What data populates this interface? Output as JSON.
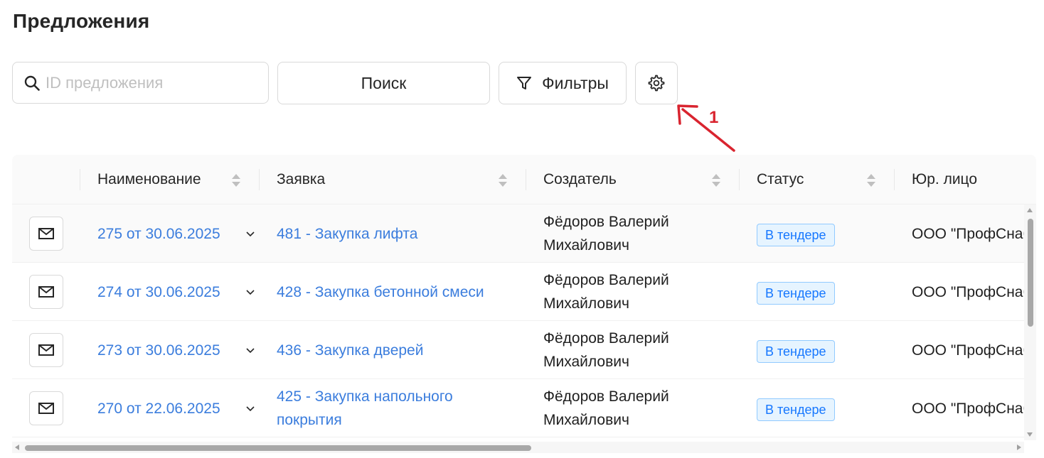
{
  "page": {
    "title": "Предложения"
  },
  "toolbar": {
    "search_placeholder": "ID предложения",
    "search_value": "",
    "search_button_label": "Поиск",
    "filters_button_label": "Фильтры",
    "settings_icon": "gear-icon"
  },
  "annotation": {
    "number": "1",
    "color": "#d9242f"
  },
  "table": {
    "columns": [
      {
        "key": "actions",
        "label": ""
      },
      {
        "key": "name",
        "label": "Наименование"
      },
      {
        "key": "request",
        "label": "Заявка"
      },
      {
        "key": "creator",
        "label": "Создатель"
      },
      {
        "key": "status",
        "label": "Статус"
      },
      {
        "key": "legal",
        "label": "Юр. лицо"
      }
    ],
    "rows": [
      {
        "name": "275 от 30.06.2025",
        "request": "481 - Закупка лифта",
        "request2": "",
        "creator1": "Фёдоров Валерий",
        "creator2": "Михайлович",
        "status": "В тендере",
        "legal": "ООО \"ПрофСнаб"
      },
      {
        "name": "274 от 30.06.2025",
        "request": "428 - Закупка бетонной смеси",
        "request2": "",
        "creator1": "Фёдоров Валерий",
        "creator2": "Михайлович",
        "status": "В тендере",
        "legal": "ООО \"ПрофСнаб"
      },
      {
        "name": "273 от 30.06.2025",
        "request": "436 - Закупка дверей",
        "request2": "",
        "creator1": "Фёдоров Валерий",
        "creator2": "Михайлович",
        "status": "В тендере",
        "legal": "ООО \"ПрофСнаб"
      },
      {
        "name": "270 от 22.06.2025",
        "request": "425 - Закупка напольного",
        "request2": "покрытия",
        "creator1": "Фёдоров Валерий",
        "creator2": "Михайлович",
        "status": "В тендере",
        "legal": "ООО \"ПрофСнаб"
      }
    ]
  },
  "colors": {
    "link": "#3b7ddd",
    "tag_text": "#1677ff",
    "tag_bg": "#e6f4ff",
    "tag_border": "#91caff"
  }
}
